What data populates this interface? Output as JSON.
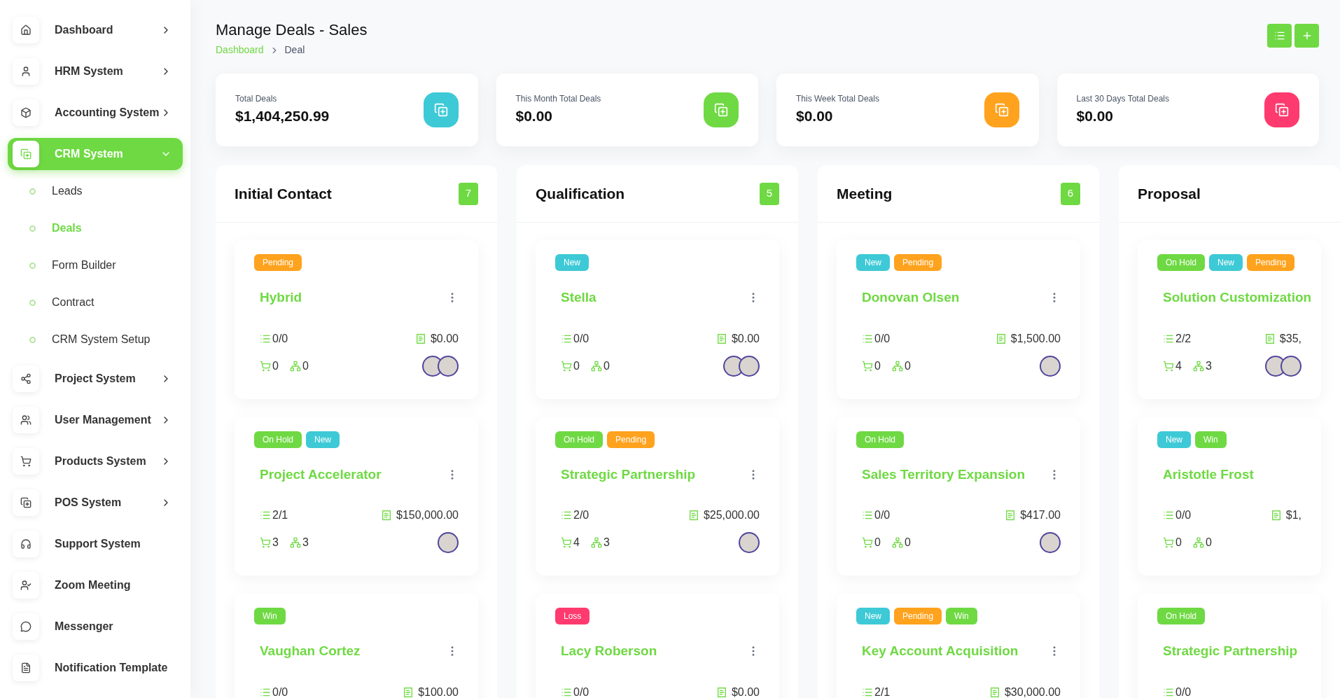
{
  "sidebar": {
    "items": [
      {
        "label": "Dashboard",
        "has_children": true,
        "expanded": false,
        "selected": false
      },
      {
        "label": "HRM System",
        "has_children": true,
        "expanded": false,
        "selected": false
      },
      {
        "label": "Accounting System",
        "has_children": true,
        "expanded": false,
        "selected": false
      },
      {
        "label": "CRM System",
        "has_children": true,
        "expanded": true,
        "selected": true,
        "children": [
          {
            "label": "Leads",
            "selected": false
          },
          {
            "label": "Deals",
            "selected": true
          },
          {
            "label": "Form Builder",
            "selected": false
          },
          {
            "label": "Contract",
            "selected": false
          },
          {
            "label": "CRM System Setup",
            "selected": false
          }
        ]
      },
      {
        "label": "Project System",
        "has_children": true,
        "expanded": false,
        "selected": false
      },
      {
        "label": "User Management",
        "has_children": true,
        "expanded": false,
        "selected": false
      },
      {
        "label": "Products System",
        "has_children": true,
        "expanded": false,
        "selected": false
      },
      {
        "label": "POS System",
        "has_children": true,
        "expanded": false,
        "selected": false
      },
      {
        "label": "Support System",
        "has_children": false,
        "expanded": false,
        "selected": false
      },
      {
        "label": "Zoom Meeting",
        "has_children": false,
        "expanded": false,
        "selected": false
      },
      {
        "label": "Messenger",
        "has_children": false,
        "expanded": false,
        "selected": false
      },
      {
        "label": "Notification Template",
        "has_children": false,
        "expanded": false,
        "selected": false
      }
    ]
  },
  "header": {
    "title": "Manage Deals - Sales",
    "breadcrumb": [
      "Dashboard",
      "Deal"
    ]
  },
  "stats": [
    {
      "label": "Total Deals",
      "value": "$1,404,250.99",
      "color": "#3ec9d6"
    },
    {
      "label": "This Month Total Deals",
      "value": "$0.00",
      "color": "#6fd943"
    },
    {
      "label": "This Week Total Deals",
      "value": "$0.00",
      "color": "#ffa21d"
    },
    {
      "label": "Last 30 Days Total Deals",
      "value": "$0.00",
      "color": "#ff3a6e"
    }
  ],
  "board": [
    {
      "title": "Initial Contact",
      "count": "7",
      "cards": [
        {
          "tags": [
            {
              "label": "Pending",
              "color": "#ffa21d"
            }
          ],
          "title": "Hybrid",
          "menu": true,
          "tasks": "0/0",
          "price": "$0.00",
          "products": "0",
          "sources": "0",
          "avatars": [
            {
              "kind": "photo"
            },
            {
              "kind": "photo"
            }
          ]
        },
        {
          "tags": [
            {
              "label": "On Hold",
              "color": "#6fd943"
            },
            {
              "label": "New",
              "color": "#3ec9d6"
            }
          ],
          "title": "Project Accelerator",
          "menu": true,
          "tasks": "2/1",
          "price": "$150,000.00",
          "products": "3",
          "sources": "3",
          "avatars": [
            {
              "kind": "photo"
            }
          ]
        },
        {
          "tags": [
            {
              "label": "Win",
              "color": "#6fd943"
            }
          ],
          "title": "Vaughan Cortez",
          "menu": true,
          "tasks": "0/0",
          "price": "$100.00"
        }
      ]
    },
    {
      "title": "Qualification",
      "count": "5",
      "cards": [
        {
          "tags": [
            {
              "label": "New",
              "color": "#3ec9d6"
            }
          ],
          "title": "Stella",
          "menu": true,
          "tasks": "0/0",
          "price": "$0.00",
          "products": "0",
          "sources": "0",
          "avatars": [
            {
              "kind": "photo"
            },
            {
              "kind": "photo"
            }
          ]
        },
        {
          "tags": [
            {
              "label": "On Hold",
              "color": "#6fd943"
            },
            {
              "label": "Pending",
              "color": "#ffa21d"
            }
          ],
          "title": "Strategic Partnership",
          "menu": true,
          "tasks": "2/0",
          "price": "$25,000.00",
          "products": "4",
          "sources": "3",
          "avatars": [
            {
              "kind": "photo"
            }
          ]
        },
        {
          "tags": [
            {
              "label": "Loss",
              "color": "#ff3a6e"
            }
          ],
          "title": "Lacy Roberson",
          "menu": true,
          "tasks": "0/0",
          "price": "$0.00"
        }
      ]
    },
    {
      "title": "Meeting",
      "count": "6",
      "cards": [
        {
          "tags": [
            {
              "label": "New",
              "color": "#3ec9d6"
            },
            {
              "label": "Pending",
              "color": "#ffa21d"
            }
          ],
          "title": "Donovan Olsen",
          "menu": true,
          "tasks": "0/0",
          "price": "$1,500.00",
          "products": "0",
          "sources": "0",
          "avatars": [
            {
              "kind": "photo"
            }
          ]
        },
        {
          "tags": [
            {
              "label": "On Hold",
              "color": "#6fd943"
            }
          ],
          "title": "Sales Territory Expansion",
          "menu": true,
          "tasks": "0/0",
          "price": "$417.00",
          "products": "0",
          "sources": "0",
          "avatars": [
            {
              "kind": "photo"
            }
          ]
        },
        {
          "tags": [
            {
              "label": "New",
              "color": "#3ec9d6"
            },
            {
              "label": "Pending",
              "color": "#ffa21d"
            },
            {
              "label": "Win",
              "color": "#6fd943"
            }
          ],
          "title": "Key Account Acquisition",
          "menu": true,
          "tasks": "2/1",
          "price": "$30,000.00"
        }
      ]
    },
    {
      "title": "Proposal",
      "cards": [
        {
          "tags": [
            {
              "label": "On Hold",
              "color": "#6fd943"
            },
            {
              "label": "New",
              "color": "#3ec9d6"
            },
            {
              "label": "Pending",
              "color": "#ffa21d"
            }
          ],
          "title": "Solution Customization",
          "tasks": "2/2",
          "price": "$35,",
          "products": "4",
          "sources": "3",
          "avatars": [
            {
              "kind": "photo"
            },
            {
              "kind": "photo"
            }
          ]
        },
        {
          "tags": [
            {
              "label": "New",
              "color": "#3ec9d6"
            },
            {
              "label": "Win",
              "color": "#6fd943"
            }
          ],
          "title": "Aristotle Frost",
          "tasks": "0/0",
          "price": "$1,",
          "products": "0",
          "sources": "0"
        },
        {
          "tags": [
            {
              "label": "On Hold",
              "color": "#6fd943"
            }
          ],
          "title": "Strategic Partnership",
          "tasks": "0/0"
        }
      ]
    }
  ]
}
